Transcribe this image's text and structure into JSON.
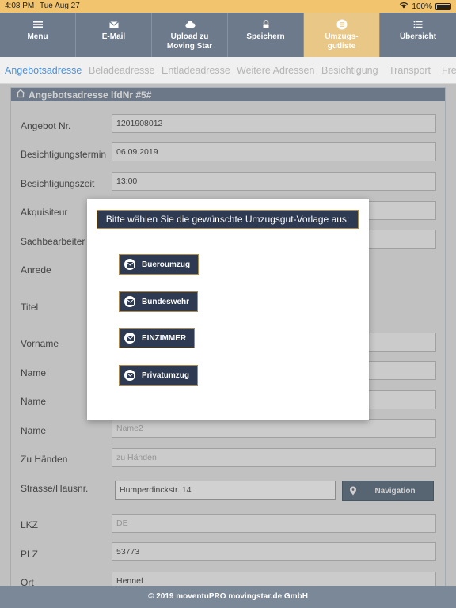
{
  "status": {
    "time": "4:08 PM",
    "date": "Tue Aug 27",
    "battery": "100%"
  },
  "toolbar": [
    {
      "label": "Menu"
    },
    {
      "label": "E-Mail"
    },
    {
      "label": "Upload zu\nMoving Star"
    },
    {
      "label": "Speichern"
    },
    {
      "label": "Umzugs-\ngutliste"
    },
    {
      "label": "Übersicht"
    }
  ],
  "tabs": [
    "Angebotsadresse",
    "Beladeadresse",
    "Entladeadresse",
    "Weitere Adressen",
    "Besichtigung",
    "Transport",
    "Fre"
  ],
  "panel": {
    "title": "Angebotsadresse lfdNr #5#"
  },
  "form": {
    "labels": [
      "Angebot Nr.",
      "Besichtigungstermin",
      "Besichtigungszeit",
      "Akquisiteur",
      "Sachbearbeiter",
      "Anrede",
      "Titel",
      "Vorname",
      "Name",
      "Name",
      "Name",
      "Zu Händen",
      "Strasse/Hausnr.",
      "LKZ",
      "PLZ",
      "Ort"
    ],
    "angebot_nr": "1201908012",
    "termin": "06.09.2019",
    "zeit": "13:00",
    "name2_placeholder": "Name2",
    "zu_haenden_placeholder": "zu Händen",
    "strasse": "Humperdinckstr. 14",
    "lkz_placeholder": "DE",
    "plz": "53773",
    "ort": "Hennef",
    "navigation_label": "Navigation"
  },
  "modal": {
    "title": "Bitte wählen Sie die gewünschte Umzugsgut-Vorlage aus:",
    "options": [
      "Bueroumzug",
      "Bundeswehr",
      "EINZIMMER",
      "Privatumzug"
    ]
  },
  "footer": {
    "text": "© 2019 moventuPRO movingstar.de GmbH"
  },
  "colors": {
    "toolbar": "#6c7a8b",
    "active": "#e9c787",
    "accent": "#4a90d9",
    "modal_button": "#2d3a52"
  }
}
